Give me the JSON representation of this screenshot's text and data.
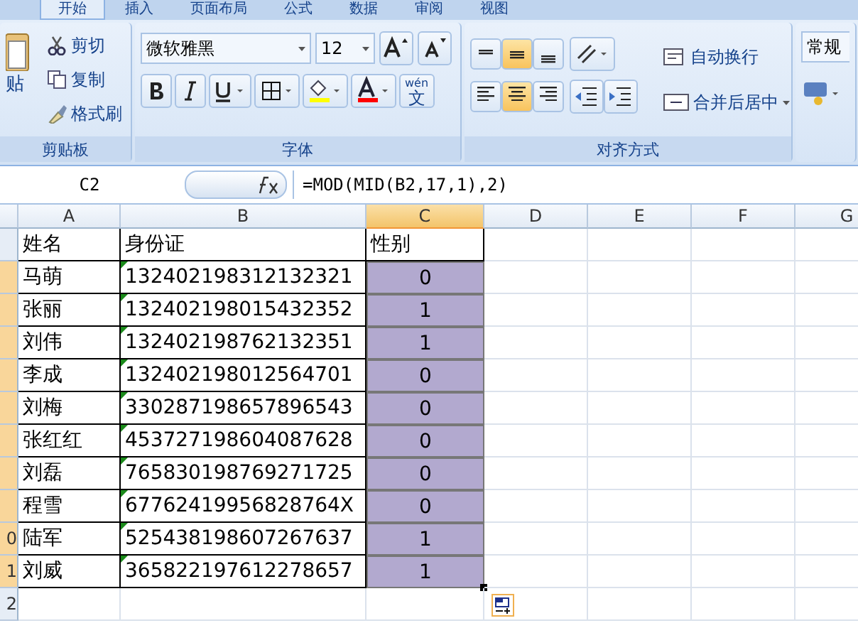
{
  "tabs": [
    {
      "label": "开始",
      "selected": true
    },
    {
      "label": "插入",
      "selected": false
    },
    {
      "label": "页面布局",
      "selected": false
    },
    {
      "label": "公式",
      "selected": false
    },
    {
      "label": "数据",
      "selected": false
    },
    {
      "label": "审阅",
      "selected": false
    },
    {
      "label": "视图",
      "selected": false
    }
  ],
  "clipboard": {
    "paste": "贴",
    "cut": "剪切",
    "copy": "复制",
    "format_painter": "格式刷",
    "label": "剪贴板"
  },
  "font": {
    "name": "微软雅黑",
    "size": "12",
    "phonetic_top": "wén",
    "phonetic_main": "文",
    "label": "字体"
  },
  "alignment": {
    "vertical": [
      {
        "selected": false
      },
      {
        "selected": true
      },
      {
        "selected": false
      }
    ],
    "horizontal": [
      {
        "selected": false
      },
      {
        "selected": true
      },
      {
        "selected": false
      }
    ],
    "wrap": "自动换行",
    "merge": "合并后居中",
    "label": "对齐方式"
  },
  "number": {
    "format": "常规"
  },
  "formula_bar": {
    "name_box": "C2",
    "formula": "=MOD(MID(B2,17,1),2)"
  },
  "sheet": {
    "columns": [
      {
        "label": "A",
        "selected": false
      },
      {
        "label": "B",
        "selected": false
      },
      {
        "label": "C",
        "selected": true
      },
      {
        "label": "D",
        "selected": false
      },
      {
        "label": "E",
        "selected": false
      },
      {
        "label": "F",
        "selected": false
      },
      {
        "label": "G",
        "selected": false
      }
    ],
    "rows": [
      {
        "cells": [
          "姓名",
          "身份证",
          "性别"
        ],
        "selected": false,
        "flagged": false
      },
      {
        "cells": [
          "马萌",
          "132402198312132321",
          "0"
        ],
        "selected": true,
        "flagged": true
      },
      {
        "cells": [
          "张丽",
          "132402198015432352",
          "1"
        ],
        "selected": true,
        "flagged": true
      },
      {
        "cells": [
          "刘伟",
          "132402198762132351",
          "1"
        ],
        "selected": true,
        "flagged": true
      },
      {
        "cells": [
          "李成",
          "132402198012564701",
          "0"
        ],
        "selected": true,
        "flagged": true
      },
      {
        "cells": [
          "刘梅",
          "330287198657896543",
          "0"
        ],
        "selected": true,
        "flagged": true
      },
      {
        "cells": [
          "张红红",
          "453727198604087628",
          "0"
        ],
        "selected": true,
        "flagged": true
      },
      {
        "cells": [
          "刘磊",
          "765830198769271725",
          "0"
        ],
        "selected": true,
        "flagged": true
      },
      {
        "cells": [
          "程雪",
          "67762419956828764X",
          "0"
        ],
        "selected": true,
        "flagged": true
      },
      {
        "cells": [
          "陆军",
          "525438198607267637",
          "1"
        ],
        "selected": true,
        "flagged": true,
        "row_label": "0"
      },
      {
        "cells": [
          "刘威",
          "365822197612278657",
          "1"
        ],
        "selected": true,
        "flagged": true,
        "row_label": "1"
      },
      {
        "cells": [],
        "selected": false,
        "flagged": false,
        "row_label": "2"
      }
    ]
  }
}
